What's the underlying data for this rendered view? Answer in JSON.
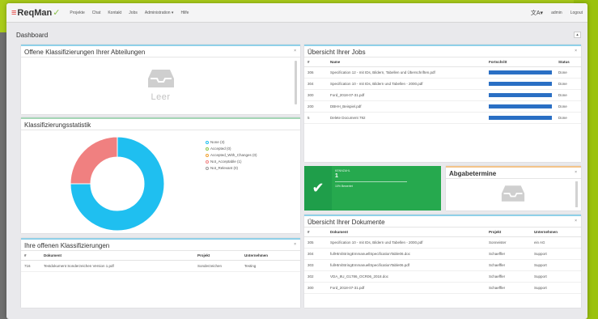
{
  "navbar": {
    "logo_text": "ReqMan",
    "items": [
      "Projekte",
      "Chat",
      "Kontakt",
      "Jobs",
      "Administration ▾",
      "Hilfe"
    ],
    "language_icon": "translate-icon",
    "user": "admin",
    "logout": "Logout"
  },
  "page_title": "Dashboard",
  "collapse_symbol": "▴",
  "close_symbol": "×",
  "offene_abteilungen": {
    "title": "Offene Klassifizierungen Ihrer Abteilungen",
    "empty_text": "Leer"
  },
  "statistik": {
    "title": "Klassifizierungsstatistik",
    "legend": [
      {
        "label": "None (3)",
        "color": "#1fbff0"
      },
      {
        "label": "Accepted (0)",
        "color": "#8bc34a"
      },
      {
        "label": "Accepted_With_Changes (0)",
        "color": "#f0a030"
      },
      {
        "label": "Not_Acceptable (1)",
        "color": "#f08080"
      },
      {
        "label": "Not_Relevant (0)",
        "color": "#999999"
      }
    ]
  },
  "chart_data": {
    "type": "pie",
    "categories": [
      "None",
      "Accepted",
      "Accepted_With_Changes",
      "Not_Acceptable",
      "Not_Relevant"
    ],
    "values": [
      3,
      0,
      0,
      1,
      0
    ],
    "colors": [
      "#1fbff0",
      "#8bc34a",
      "#f0a030",
      "#f08080",
      "#999999"
    ],
    "donut": true,
    "legend_position": "right"
  },
  "offene_klassifizierungen": {
    "title": "Ihre offenen Klassifizierungen",
    "headers": [
      "#",
      "Dokument",
      "Projekt",
      "Unternehmen"
    ],
    "rows": [
      [
        "716",
        "Testdokument Sonderzeichen Version 1.pdf",
        "Sonderzeichen",
        "Testing"
      ]
    ]
  },
  "jobs": {
    "title": "Übersicht Ihrer Jobs",
    "headers": [
      "#",
      "Name",
      "Fortschritt",
      "Status"
    ],
    "rows": [
      {
        "id": "306",
        "name": "Specification 12 - mit IDs, Bildern, Tabellen und Überschriften.pdf",
        "progress": 1.0,
        "status": "Done"
      },
      {
        "id": "304",
        "name": "Specification 10 - mit IDs, Bildern und Tabellen - 2000.pdf",
        "progress": 1.0,
        "status": "Done"
      },
      {
        "id": "300",
        "name": "Ford_2018-07-31.pdf",
        "progress": 1.0,
        "status": "Done"
      },
      {
        "id": "200",
        "name": "DBHH_Beispiel.pdf",
        "progress": 1.0,
        "status": "Done"
      },
      {
        "id": "5",
        "name": "Delete Document 792",
        "progress": 1.0,
        "status": "Done"
      }
    ]
  },
  "kennzahl": {
    "label": "Kennzahl",
    "value": "1",
    "sub": "10% Bewertet"
  },
  "abgabetermine": {
    "title": "Abgabetermine"
  },
  "dokumente": {
    "title": "Übersicht Ihrer Dokumente",
    "headers": [
      "#",
      "Dokument",
      "Projekt",
      "Unternehmen"
    ],
    "rows": [
      [
        "305",
        "Specification 10 - mit IDs, Bildern und Tabellen - 2000.pdf",
        "Sonneister",
        "ein AG"
      ],
      [
        "304",
        "fullHtmlStringEmmanuellSpecificationTable06.doc",
        "Schaeffler",
        "Support"
      ],
      [
        "303",
        "fullHtmlStringEmmanuellSpecificationTable06.pdf",
        "Schaeffler",
        "Support"
      ],
      [
        "302",
        "VDA_8U_G1786_OCR06_2018.doc",
        "Schaeffler",
        "Support"
      ],
      [
        "300",
        "Ford_2018-07-31.pdf",
        "Schaeffler",
        "Support"
      ]
    ]
  }
}
